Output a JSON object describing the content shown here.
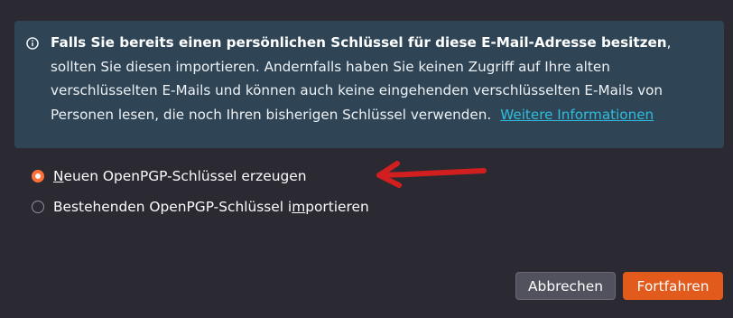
{
  "info": {
    "bold_text": "Falls Sie bereits einen persönlichen Schlüssel für diese E-Mail-Adresse besitzen",
    "body_text": ", sollten Sie diesen importieren. Andernfalls haben Sie keinen Zugriff auf Ihre alten verschlüsselten E-Mails und können auch keine eingehenden verschlüsselten E-Mails von Personen lesen, die noch Ihren bisherigen Schlüssel verwenden.",
    "link_text": "Weitere Informationen"
  },
  "options": [
    {
      "label_accesskey": "N",
      "label_rest": "euen OpenPGP-Schlüssel erzeugen",
      "selected": true
    },
    {
      "label_before": "Bestehenden OpenPGP-Schlüssel i",
      "label_accesskey": "m",
      "label_after": "portieren",
      "selected": false
    }
  ],
  "buttons": {
    "cancel": "Abbrechen",
    "continue": "Fortfahren"
  },
  "colors": {
    "accent": "#ff7139",
    "primary_button": "#e35a1d",
    "info_background": "#2f4556",
    "link": "#2ebddf",
    "annotation_arrow": "#d11f1f"
  }
}
